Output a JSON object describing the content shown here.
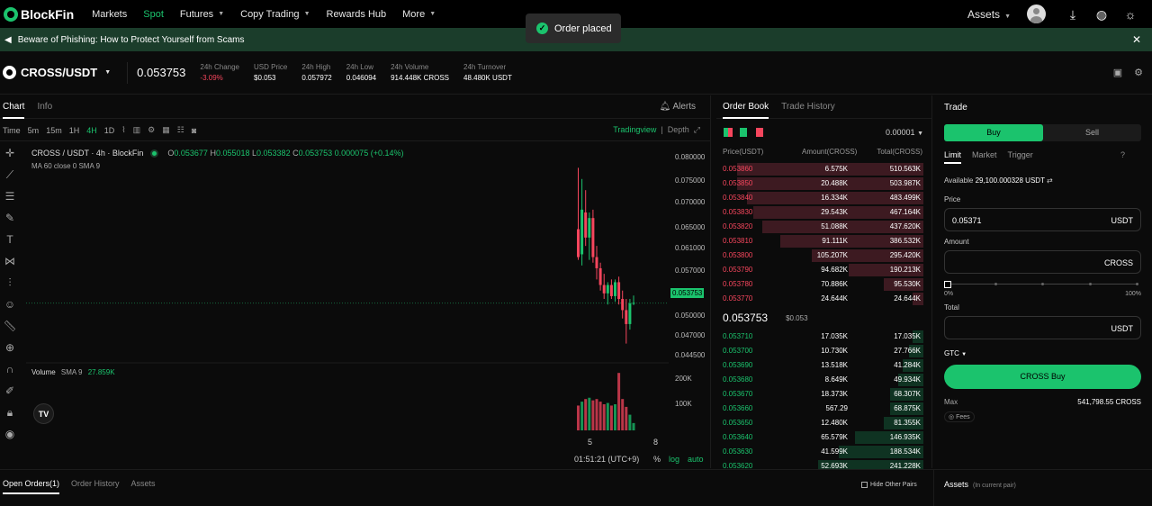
{
  "nav": {
    "logo": "BlockFin",
    "items": [
      {
        "label": "Markets",
        "active": false,
        "dropdown": false
      },
      {
        "label": "Spot",
        "active": true,
        "dropdown": false
      },
      {
        "label": "Futures",
        "active": false,
        "dropdown": true
      },
      {
        "label": "Copy Trading",
        "active": false,
        "dropdown": true
      },
      {
        "label": "Rewards Hub",
        "active": false,
        "dropdown": false
      },
      {
        "label": "More",
        "active": false,
        "dropdown": true
      }
    ],
    "assets_label": "Assets",
    "icons": [
      "avatar",
      "download-icon",
      "globe-icon",
      "theme-icon"
    ]
  },
  "toast": {
    "text": "Order placed"
  },
  "banner": {
    "text": "Beware of Phishing: How to Protect Yourself from Scams"
  },
  "ticker": {
    "pair": "CROSS/USDT",
    "last_price": "0.053753",
    "stats": [
      {
        "label": "24h Change",
        "value": "-3.09%",
        "negative": true
      },
      {
        "label": "USD Price",
        "value": "$0.053",
        "negative": false
      },
      {
        "label": "24h High",
        "value": "0.057972",
        "negative": false
      },
      {
        "label": "24h Low",
        "value": "0.046094",
        "negative": false
      },
      {
        "label": "24h Volume",
        "value": "914.448K CROSS",
        "negative": false
      },
      {
        "label": "24h Turnover",
        "value": "48.480K USDT",
        "negative": false
      }
    ]
  },
  "chart_panel": {
    "tabs": [
      "Chart",
      "Info"
    ],
    "alerts_label": "Alerts",
    "timeframes": [
      "Time",
      "5m",
      "15m",
      "1H",
      "4H",
      "1D"
    ],
    "active_timeframe": "4H",
    "view_tradingview": "Tradingview",
    "view_depth": "Depth",
    "legend_title": "CROSS / USDT · 4h · BlockFin",
    "ohlc": {
      "o": "0.053677",
      "h": "0.055018",
      "l": "0.053382",
      "c": "0.053753",
      "chg": "0.000075 (+0.14%)"
    },
    "ma_label": "MA 60 close 0 SMA 9",
    "volume_label": "Volume",
    "volume_sma": "SMA 9",
    "volume_value": "27.859K",
    "footer_time": "01:51:21 (UTC+9)",
    "footer_pct": "%",
    "footer_log": "log",
    "footer_auto": "auto",
    "tv_logo": "TV"
  },
  "chart_data": {
    "type": "candlestick",
    "price_axis": [
      "0.080000",
      "0.075000",
      "0.070000",
      "0.065000",
      "0.061000",
      "0.057000",
      "0.053753",
      "0.050000",
      "0.047000",
      "0.044500"
    ],
    "volume_axis": [
      "200K",
      "100K"
    ],
    "x_ticks": [
      "5",
      "8"
    ],
    "current_price": 0.053753,
    "candles": [
      {
        "o": 0.067,
        "h": 0.078,
        "l": 0.0615,
        "c": 0.062
      },
      {
        "o": 0.0625,
        "h": 0.076,
        "l": 0.0605,
        "c": 0.0705
      },
      {
        "o": 0.07,
        "h": 0.074,
        "l": 0.064,
        "c": 0.0655
      },
      {
        "o": 0.0655,
        "h": 0.07,
        "l": 0.0615,
        "c": 0.069
      },
      {
        "o": 0.069,
        "h": 0.0705,
        "l": 0.061,
        "c": 0.062
      },
      {
        "o": 0.062,
        "h": 0.064,
        "l": 0.058,
        "c": 0.06
      },
      {
        "o": 0.06,
        "h": 0.061,
        "l": 0.056,
        "c": 0.057
      },
      {
        "o": 0.057,
        "h": 0.059,
        "l": 0.0545,
        "c": 0.0555
      },
      {
        "o": 0.0555,
        "h": 0.0575,
        "l": 0.0535,
        "c": 0.057
      },
      {
        "o": 0.057,
        "h": 0.058,
        "l": 0.0545,
        "c": 0.055
      },
      {
        "o": 0.055,
        "h": 0.058,
        "l": 0.054,
        "c": 0.0575
      },
      {
        "o": 0.0575,
        "h": 0.0585,
        "l": 0.0535,
        "c": 0.0545
      },
      {
        "o": 0.0545,
        "h": 0.056,
        "l": 0.051,
        "c": 0.0525
      },
      {
        "o": 0.0525,
        "h": 0.0545,
        "l": 0.0465,
        "c": 0.05
      },
      {
        "o": 0.05,
        "h": 0.0545,
        "l": 0.049,
        "c": 0.0537
      },
      {
        "o": 0.0537,
        "h": 0.0551,
        "l": 0.0534,
        "c": 0.0538
      }
    ],
    "volumes": [
      95,
      110,
      120,
      125,
      115,
      120,
      110,
      100,
      105,
      95,
      100,
      220,
      120,
      90,
      60,
      28
    ]
  },
  "orderbook": {
    "tabs": [
      "Order Book",
      "Trade History"
    ],
    "tick": "0.00001",
    "columns": [
      "Price(USDT)",
      "Amount(CROSS)",
      "Total(CROSS)"
    ],
    "asks": [
      {
        "price": "0.053860",
        "amount": "6.575K",
        "total": "510.563K",
        "depth": 0.9
      },
      {
        "price": "0.053850",
        "amount": "20.488K",
        "total": "503.987K",
        "depth": 0.9
      },
      {
        "price": "0.053840",
        "amount": "16.334K",
        "total": "483.499K",
        "depth": 0.85
      },
      {
        "price": "0.053830",
        "amount": "29.543K",
        "total": "467.164K",
        "depth": 0.82
      },
      {
        "price": "0.053820",
        "amount": "51.088K",
        "total": "437.620K",
        "depth": 0.78
      },
      {
        "price": "0.053810",
        "amount": "91.111K",
        "total": "386.532K",
        "depth": 0.69
      },
      {
        "price": "0.053800",
        "amount": "105.207K",
        "total": "295.420K",
        "depth": 0.54
      },
      {
        "price": "0.053790",
        "amount": "94.682K",
        "total": "190.213K",
        "depth": 0.36
      },
      {
        "price": "0.053780",
        "amount": "70.886K",
        "total": "95.530K",
        "depth": 0.19
      },
      {
        "price": "0.053770",
        "amount": "24.644K",
        "total": "24.644K",
        "depth": 0.05
      }
    ],
    "mid_price": "0.053753",
    "mid_usd": "$0.053",
    "bids": [
      {
        "price": "0.053710",
        "amount": "17.035K",
        "total": "17.035K",
        "depth": 0.05
      },
      {
        "price": "0.053700",
        "amount": "10.730K",
        "total": "27.766K",
        "depth": 0.07
      },
      {
        "price": "0.053690",
        "amount": "13.518K",
        "total": "41.284K",
        "depth": 0.1
      },
      {
        "price": "0.053680",
        "amount": "8.649K",
        "total": "49.934K",
        "depth": 0.12
      },
      {
        "price": "0.053670",
        "amount": "18.373K",
        "total": "68.307K",
        "depth": 0.16
      },
      {
        "price": "0.053660",
        "amount": "567.29",
        "total": "68.875K",
        "depth": 0.16
      },
      {
        "price": "0.053650",
        "amount": "12.480K",
        "total": "81.355K",
        "depth": 0.19
      },
      {
        "price": "0.053640",
        "amount": "65.579K",
        "total": "146.935K",
        "depth": 0.33
      },
      {
        "price": "0.053630",
        "amount": "41.599K",
        "total": "188.534K",
        "depth": 0.41
      },
      {
        "price": "0.053620",
        "amount": "52.693K",
        "total": "241.228K",
        "depth": 0.51
      }
    ]
  },
  "trade": {
    "title": "Trade",
    "buy": "Buy",
    "sell": "Sell",
    "order_types": [
      "Limit",
      "Market",
      "Trigger"
    ],
    "available_label": "Available",
    "available_value": "29,100.000328 USDT",
    "price_label": "Price",
    "price_value": "0.05371",
    "price_unit": "USDT",
    "amount_label": "Amount",
    "amount_unit": "CROSS",
    "slider_min": "0%",
    "slider_max": "100%",
    "slider_value": 0,
    "total_label": "Total",
    "total_unit": "USDT",
    "tif": "GTC",
    "cta": "CROSS Buy",
    "max_label": "Max",
    "max_value": "541,798.55 CROSS",
    "fees_label": "Fees"
  },
  "bottom": {
    "tabs": [
      "Open Orders(1)",
      "Order History",
      "Assets"
    ],
    "hide_other_pairs": "Hide Other Pairs",
    "assets_title": "Assets",
    "assets_sub": "(In current pair)"
  }
}
